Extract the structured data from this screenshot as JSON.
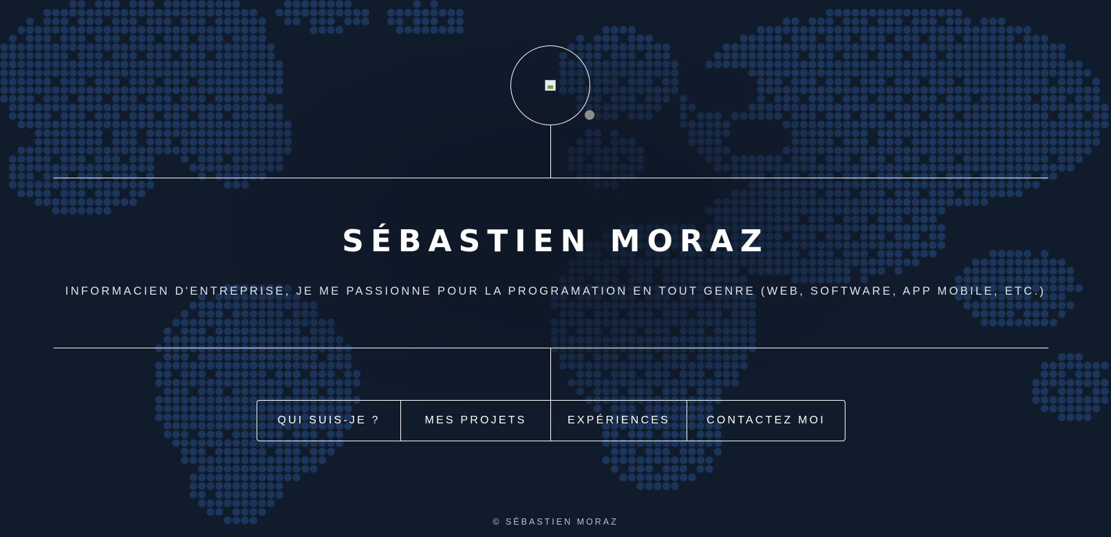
{
  "header": {
    "logo_alt": "image",
    "name": "SÉBASTIEN MORAZ",
    "tagline": "INFORMACIEN D'ENTREPRISE, JE ME PASSIONNE POUR LA PROGRAMATION EN TOUT GENRE (WEB, SOFTWARE, APP MOBILE, ETC.)"
  },
  "nav": {
    "items": [
      {
        "label": "QUI SUIS-JE ?"
      },
      {
        "label": "MES PROJETS"
      },
      {
        "label": "EXPÉRIENCES"
      },
      {
        "label": "CONTACTEZ MOI"
      }
    ]
  },
  "footer": {
    "copyright": "© SÉBASTIEN MORAZ"
  },
  "colors": {
    "background": "#101b2c",
    "map_dot": "#1c355a",
    "line": "#ffffff",
    "indicator_dot": "#8c8c8c"
  },
  "icons": {
    "logo": "broken-image-icon",
    "background": "world-map-dots"
  }
}
